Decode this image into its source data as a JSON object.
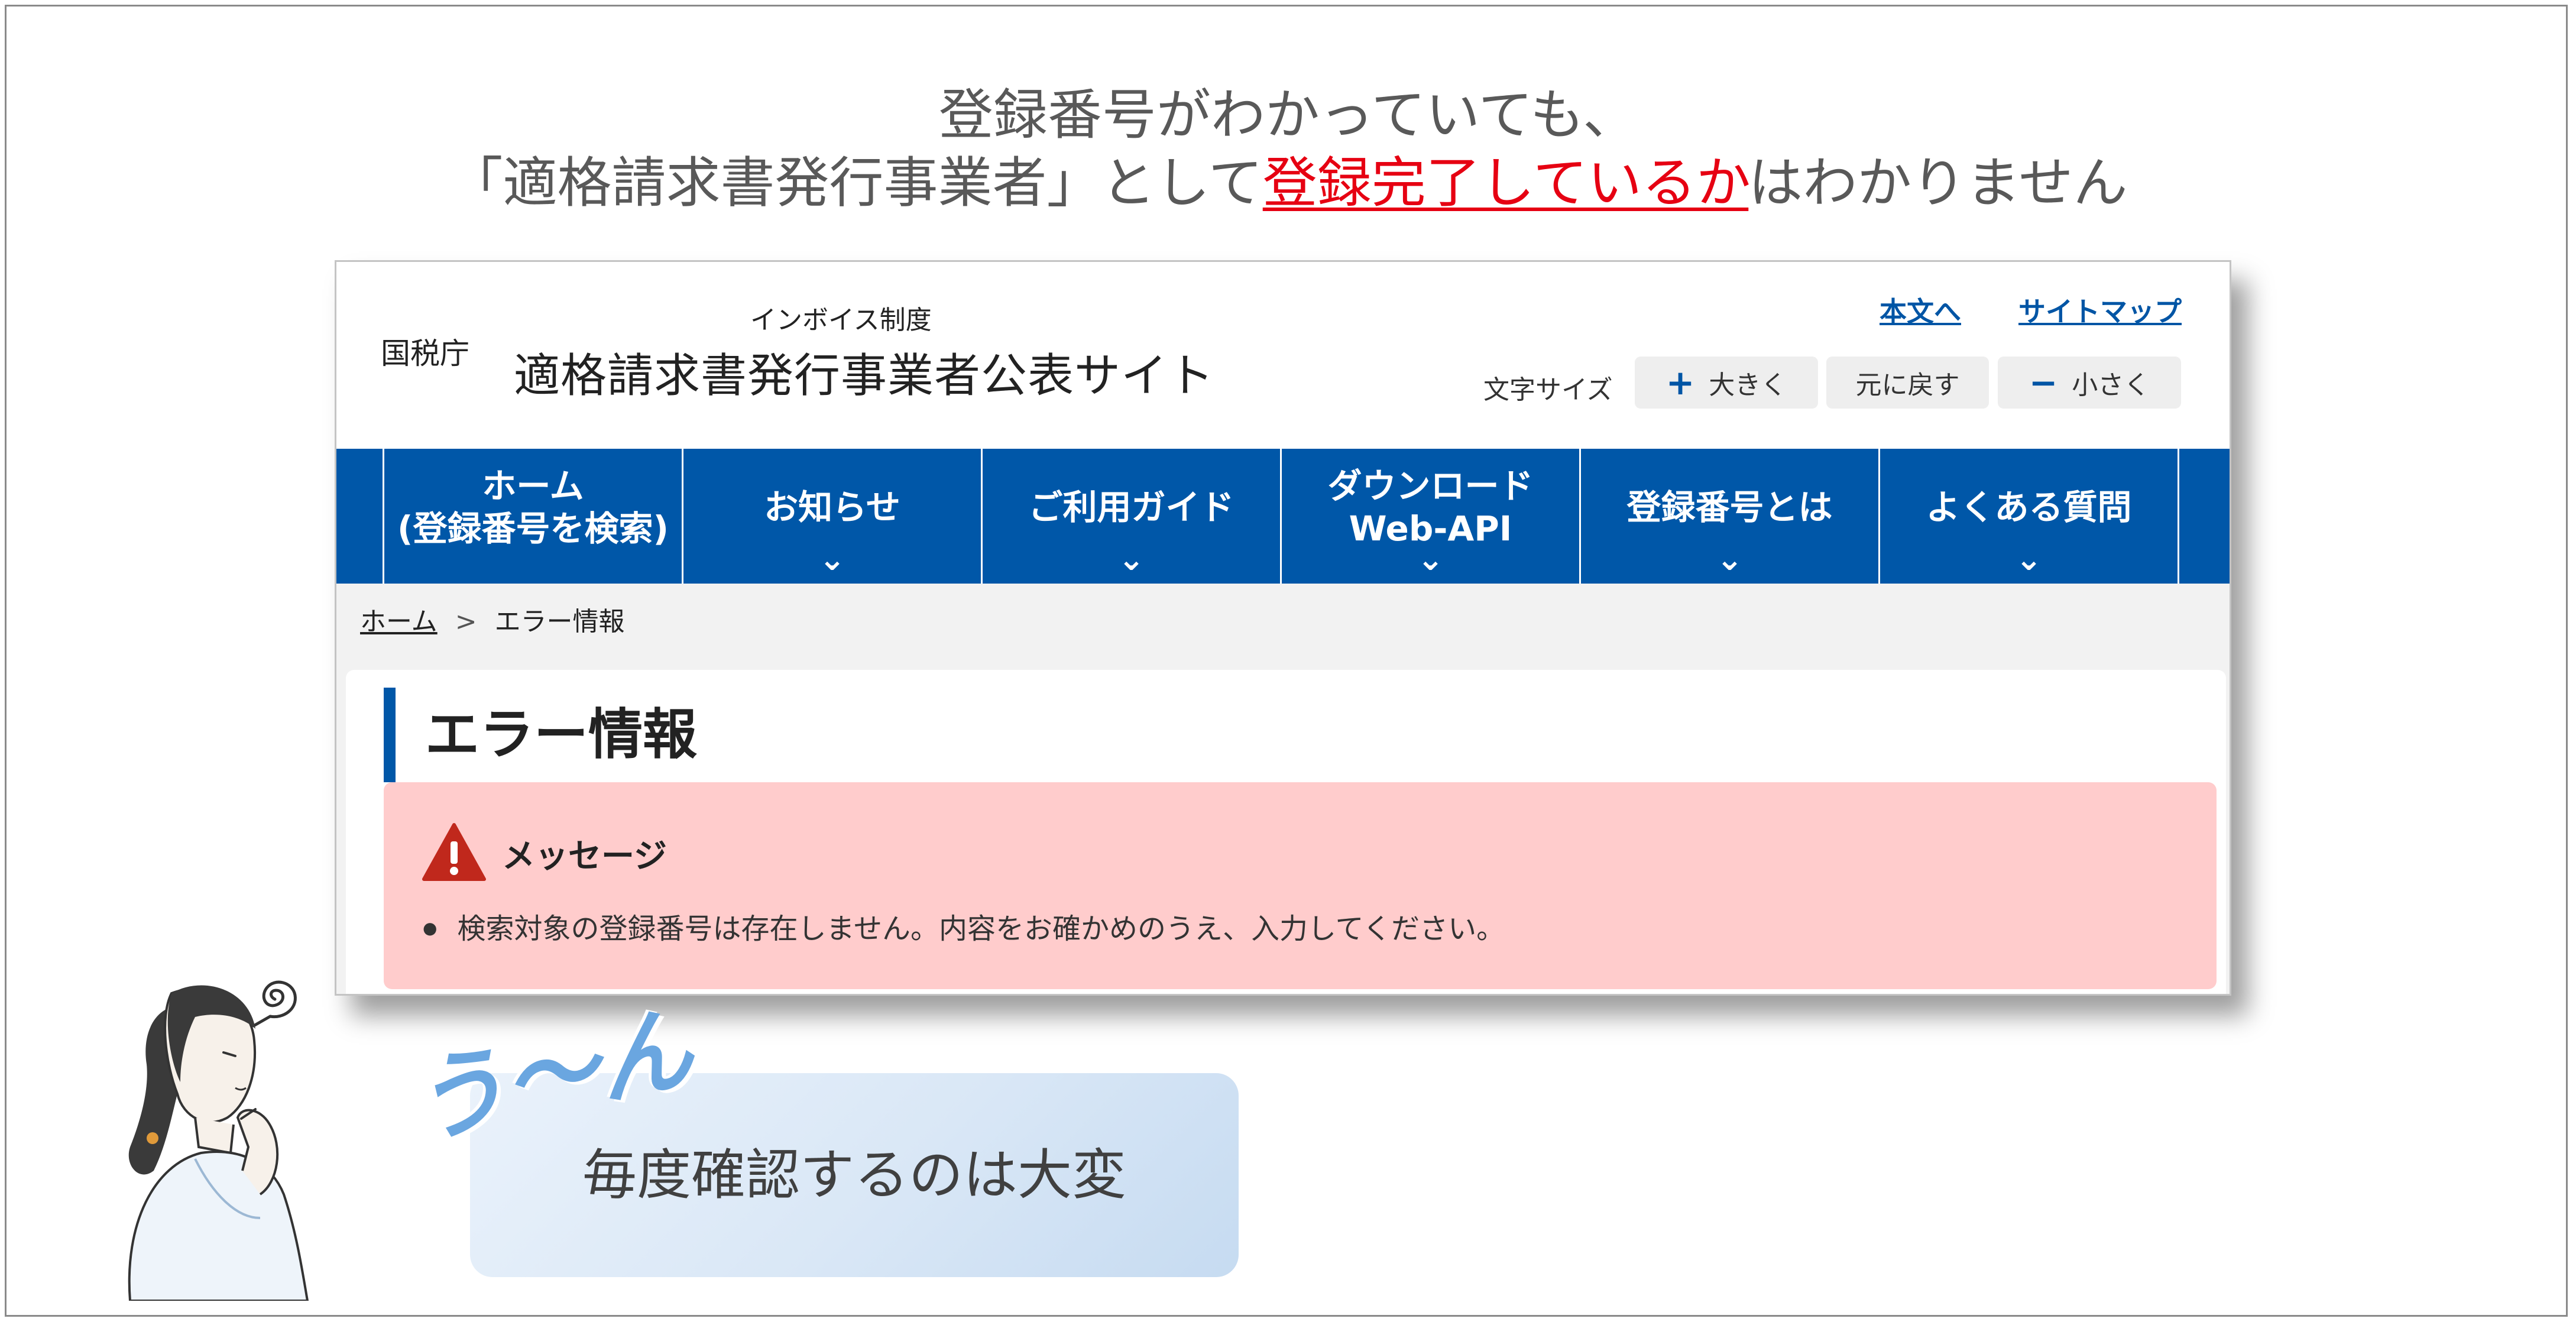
{
  "headline": {
    "line1": "登録番号がわかっていても、",
    "line2_before": "「適格請求書発行事業者」として",
    "line2_highlight": "登録完了しているか",
    "line2_after": "はわかりません"
  },
  "site": {
    "agency": "国税庁",
    "subtitle": "インボイス制度",
    "title": "適格請求書発行事業者公表サイト",
    "util_links": {
      "main_text": "本文へ",
      "sitemap": "サイトマップ"
    },
    "font_size": {
      "label": "文字サイズ",
      "larger": "大きく",
      "reset": "元に戻す",
      "smaller": "小さく",
      "plus_symbol": "+",
      "minus_symbol": "−"
    },
    "nav": [
      {
        "label": "ホーム\n(登録番号を検索)",
        "has_chevron": false
      },
      {
        "label": "お知らせ",
        "has_chevron": true
      },
      {
        "label": "ご利用ガイド",
        "has_chevron": true
      },
      {
        "label": "ダウンロード\nWeb-API",
        "has_chevron": true
      },
      {
        "label": "登録番号とは",
        "has_chevron": true
      },
      {
        "label": "よくある質問",
        "has_chevron": true
      }
    ],
    "chevron_glyph": "⌄",
    "breadcrumb": {
      "home": "ホーム",
      "separator": ">",
      "current": "エラー情報"
    },
    "page_title": "エラー情報",
    "alert": {
      "title": "メッセージ",
      "message": "検索対象の登録番号は存在しません。内容をお確かめのうえ、入力してください。",
      "icon": "warning-triangle-icon"
    }
  },
  "callout": {
    "exclamation": "う～ん",
    "text": "毎度確認するのは大変"
  },
  "colors": {
    "nav_blue": "#0057a8",
    "highlight_red": "#e60012",
    "alert_bg": "#ffcccc",
    "warning_red": "#c0281c",
    "exclamation_blue": "#6aa6e0"
  }
}
